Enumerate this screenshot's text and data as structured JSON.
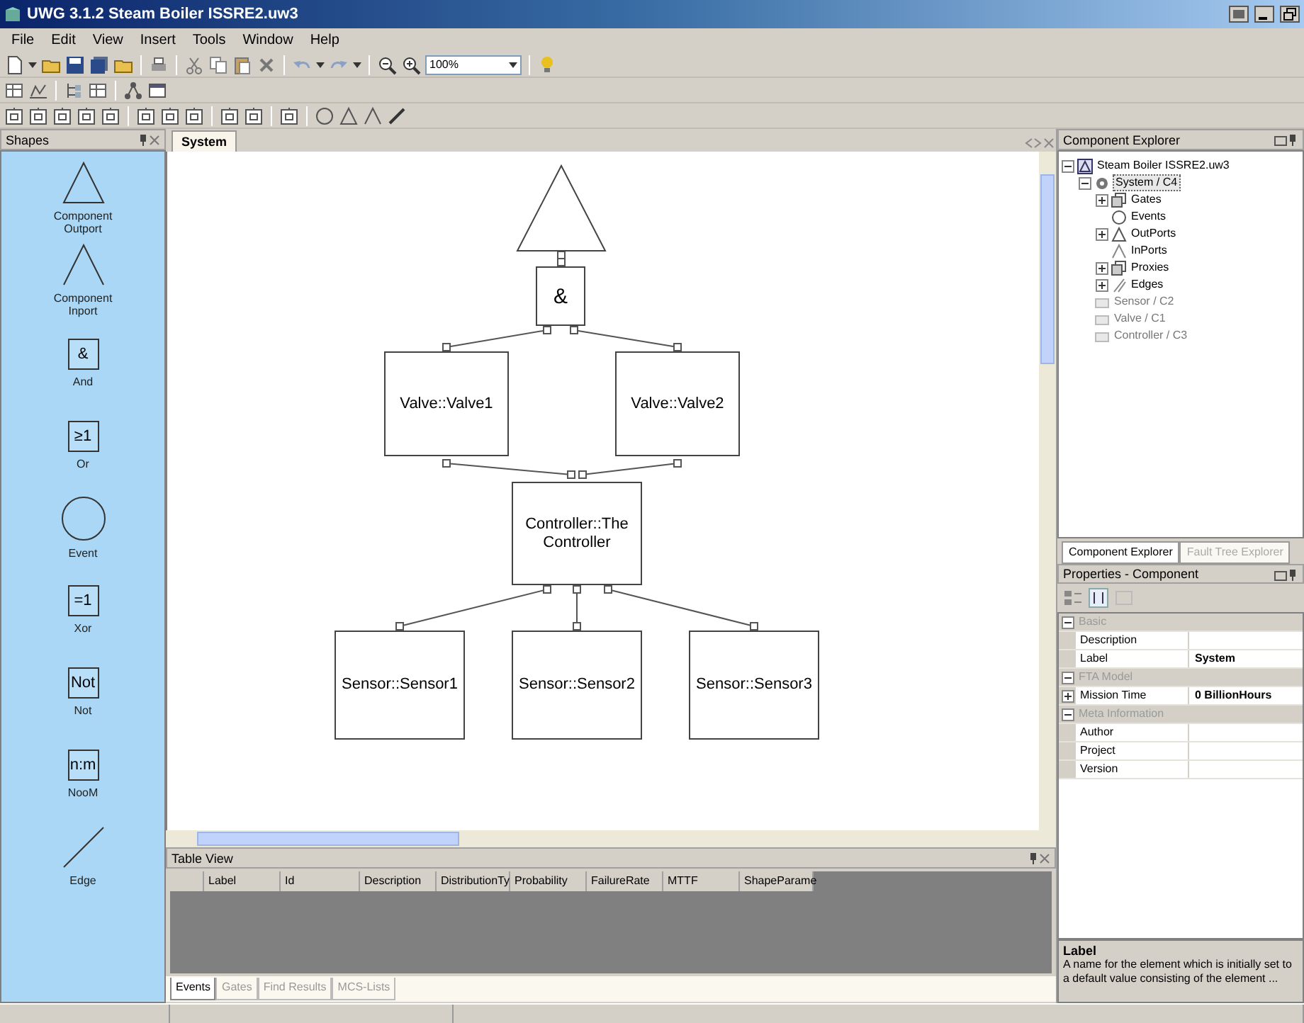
{
  "window": {
    "title": "UWG 3.1.2  Steam Boiler ISSRE2.uw3"
  },
  "menu": [
    "File",
    "Edit",
    "View",
    "Insert",
    "Tools",
    "Window",
    "Help"
  ],
  "toolbar": {
    "zoom": "100%"
  },
  "shapes_panel": {
    "title": "Shapes",
    "items": [
      {
        "kind": "outport",
        "label": "Component Outport"
      },
      {
        "kind": "inport",
        "label": "Component Inport"
      },
      {
        "kind": "gate",
        "symbol": "&",
        "label": "And"
      },
      {
        "kind": "gate",
        "symbol": "≥1",
        "label": "Or"
      },
      {
        "kind": "event",
        "label": "Event"
      },
      {
        "kind": "gate",
        "symbol": "=1",
        "label": "Xor"
      },
      {
        "kind": "gate",
        "symbol": "Not",
        "label": "Not"
      },
      {
        "kind": "gate",
        "symbol": "n:m",
        "label": "NooM"
      },
      {
        "kind": "edge",
        "label": "Edge"
      }
    ]
  },
  "document": {
    "tab": "System",
    "nodes": [
      {
        "kind": "outport"
      },
      {
        "kind": "gate",
        "label": "&"
      },
      {
        "kind": "component",
        "label": "Valve::Valve1"
      },
      {
        "kind": "component",
        "label": "Valve::Valve2"
      },
      {
        "kind": "component",
        "label": "Controller::The Controller"
      },
      {
        "kind": "component",
        "label": "Sensor::Sensor1"
      },
      {
        "kind": "component",
        "label": "Sensor::Sensor2"
      },
      {
        "kind": "component",
        "label": "Sensor::Sensor3"
      }
    ]
  },
  "table_view": {
    "title": "Table View",
    "columns": [
      "Label",
      "Id",
      "Description",
      "DistributionTy",
      "Probability",
      "FailureRate",
      "MTTF",
      "ShapeParame"
    ],
    "tabs": [
      {
        "label": "Events",
        "selected": true
      },
      {
        "label": "Gates",
        "selected": false
      },
      {
        "label": "Find Results",
        "selected": false
      },
      {
        "label": "MCS-Lists",
        "selected": false
      }
    ]
  },
  "component_explorer": {
    "title": "Component Explorer",
    "tree": [
      {
        "label": "Steam Boiler ISSRE2.uw3",
        "kind": "file",
        "expanded": true,
        "selected": false,
        "children": [
          {
            "label": "System / C4",
            "kind": "system",
            "expanded": true,
            "selected": true,
            "children": [
              {
                "label": "Gates",
                "kind": "gates",
                "expanded": false,
                "selected": false
              },
              {
                "label": "Events",
                "kind": "event",
                "selected": false
              },
              {
                "label": "OutPorts",
                "kind": "outport",
                "expanded": false,
                "selected": false
              },
              {
                "label": "InPorts",
                "kind": "inport",
                "selected": false
              },
              {
                "label": "Proxies",
                "kind": "gates",
                "expanded": false,
                "selected": false
              },
              {
                "label": "Edges",
                "kind": "edges",
                "expanded": false,
                "selected": false
              }
            ]
          },
          {
            "label": "Sensor / C2",
            "kind": "component",
            "selected": false
          },
          {
            "label": "Valve / C1",
            "kind": "component",
            "selected": false
          },
          {
            "label": "Controller / C3",
            "kind": "component",
            "selected": false
          }
        ]
      }
    ]
  },
  "explorer_tabs": [
    {
      "label": "Component Explorer",
      "selected": true
    },
    {
      "label": "Fault Tree Explorer",
      "selected": false
    }
  ],
  "properties": {
    "title": "Properties - Component",
    "categories": [
      {
        "name": "Basic",
        "expanded": true,
        "rows": [
          {
            "name": "Description",
            "expandable": false
          },
          {
            "name": "Label",
            "value": "System",
            "expandable": false
          }
        ]
      },
      {
        "name": "FTA Model",
        "expanded": true,
        "rows": [
          {
            "name": "Mission Time",
            "value": "0 BillionHours",
            "expandable": true
          }
        ]
      },
      {
        "name": "Meta Information",
        "expanded": true,
        "rows": [
          {
            "name": "Author",
            "expandable": false
          },
          {
            "name": "Project",
            "expandable": false
          },
          {
            "name": "Version",
            "expandable": false
          }
        ]
      }
    ]
  },
  "description": {
    "title": "Label",
    "text": "A name for the element which is initially set to a default value consisting of the element ..."
  }
}
